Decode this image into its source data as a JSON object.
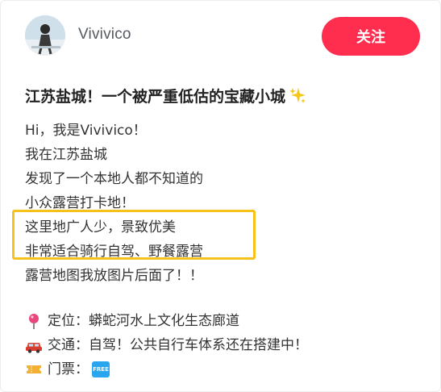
{
  "post": {
    "author": {
      "username": "Vivivico",
      "avatar_icon": "avatar-photo"
    },
    "follow_label": "关注",
    "accent_color": "#ff2e4f",
    "title": "江苏盐城！一个被严重低估的宝藏小城",
    "title_emoji_icon": "sparkles-icon",
    "body_lines": [
      "Hi，我是Vivivico！",
      "我在江苏盐城",
      "发现了一个本地人都不知道的",
      "小众露营打卡地！",
      "这里地广人少，景致优美",
      "非常适合骑行自驾、野餐露营",
      "露营地图我放图片后面了！！"
    ],
    "highlight_color": "#f4c21b",
    "info": {
      "location": "定位：蟒蛇河水上文化生态廊道",
      "location_icon": "map-pin-icon",
      "transport": "交通：自驾！公共自行车体系还在搭建中！",
      "transport_icon": "car-icon",
      "ticket": "门票：",
      "ticket_icon": "ticket-icon",
      "ticket_badge": "FREE"
    }
  }
}
